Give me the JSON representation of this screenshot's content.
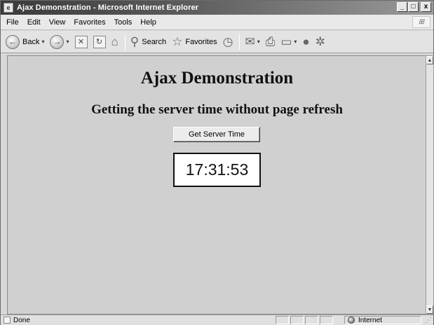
{
  "window": {
    "title": "Ajax Demonstration - Microsoft Internet Explorer",
    "controls": {
      "minimize": "_",
      "maximize": "□",
      "close": "x"
    }
  },
  "menubar": {
    "items": [
      {
        "label": "File",
        "accel": "F"
      },
      {
        "label": "Edit",
        "accel": "E"
      },
      {
        "label": "View",
        "accel": "V"
      },
      {
        "label": "Favorites",
        "accel": "a"
      },
      {
        "label": "Tools",
        "accel": "T"
      },
      {
        "label": "Help",
        "accel": "H"
      }
    ]
  },
  "toolbar": {
    "back_label": "Back",
    "search_label": "Search",
    "favorites_label": "Favorites",
    "icons": {
      "back": "←",
      "forward": "→",
      "stop": "✕",
      "refresh": "↻",
      "home": "⌂",
      "search": "⚲",
      "favorites": "☆",
      "history": "◷",
      "mail": "✉",
      "print": "⎙",
      "edit": "▭",
      "discuss": "●",
      "messenger": "✲",
      "dropdown": "▾"
    }
  },
  "page": {
    "title": "Ajax Demonstration",
    "subtitle": "Getting the server time without page refresh",
    "button_label": "Get Server Time",
    "server_time": "17:31:53"
  },
  "statusbar": {
    "status": "Done",
    "zone": "Internet",
    "grip": "⋰"
  },
  "scrollbar": {
    "up": "▲",
    "down": "▼"
  },
  "colors": {
    "titlebar_start": "#3a3a3a",
    "titlebar_end": "#9a9a9a",
    "content_bg": "#d0d0d0",
    "chrome_bg": "#e3e3e3"
  }
}
